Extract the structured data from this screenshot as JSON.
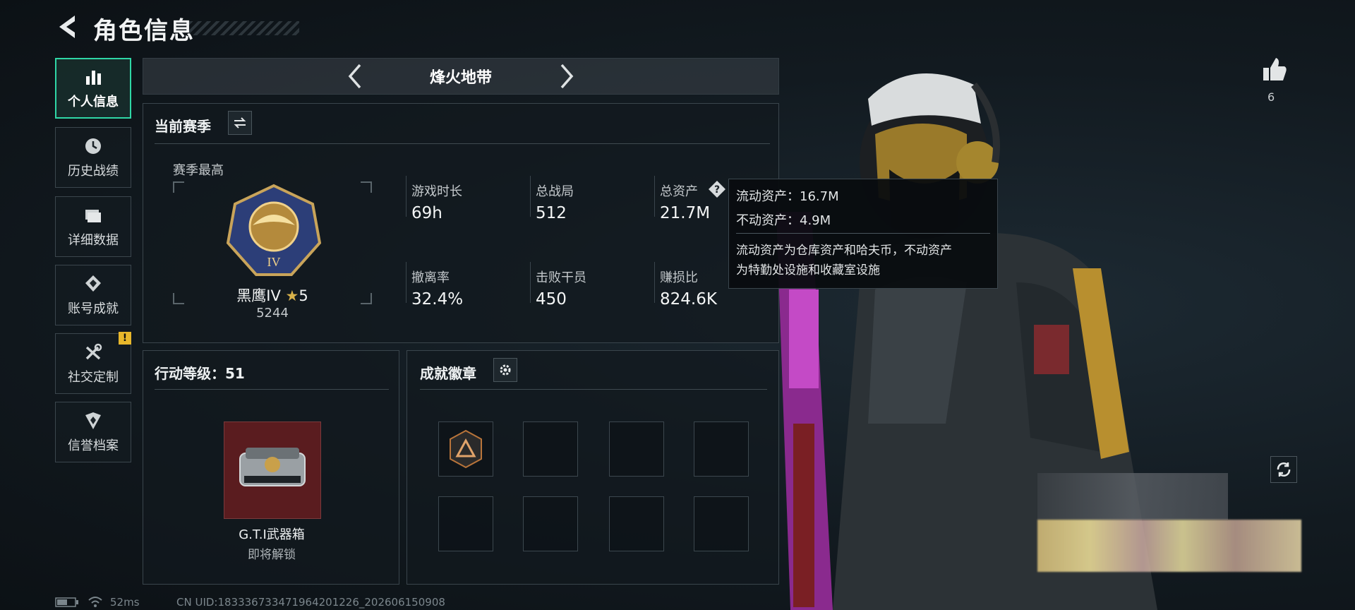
{
  "header": {
    "title": "角色信息"
  },
  "nav": [
    {
      "label": "个人信息",
      "icon": "bar-chart-icon",
      "active": true
    },
    {
      "label": "历史战绩",
      "icon": "clock-icon"
    },
    {
      "label": "详细数据",
      "icon": "folder-icon"
    },
    {
      "label": "账号成就",
      "icon": "achievement-icon"
    },
    {
      "label": "社交定制",
      "icon": "tools-icon",
      "alert": "!"
    },
    {
      "label": "信誉档案",
      "icon": "shield-icon"
    }
  ],
  "season_selector": {
    "name": "烽火地带"
  },
  "current_season": {
    "title": "当前赛季",
    "best_label": "赛季最高",
    "rank_name": "黑鹰IV",
    "rank_stars": "5",
    "rank_score": "5244",
    "stats": [
      {
        "label": "游戏时长",
        "value": "69h"
      },
      {
        "label": "总战局",
        "value": "512"
      },
      {
        "label": "总资产",
        "value": "21.7M"
      },
      {
        "label": "撤离率",
        "value": "32.4%"
      },
      {
        "label": "击败干员",
        "value": "450"
      },
      {
        "label": "赚损比",
        "value": "824.6K"
      }
    ]
  },
  "tooltip": {
    "line1": "流动资产：16.7M",
    "line2": "不动资产：4.9M",
    "desc1": "流动资产为仓库资产和哈夫币，不动资产",
    "desc2": "为特勤处设施和收藏室设施"
  },
  "action_level": {
    "title": "行动等级：51",
    "reward_name": "G.T.I武器箱",
    "reward_status": "即将解锁"
  },
  "achievements": {
    "title": "成就徽章"
  },
  "likes": {
    "count": "6"
  },
  "footer": {
    "ping": "52ms",
    "uid": "CN UID:18333673347196420122​6_202606150908"
  },
  "colors": {
    "accent": "#2fd7a6",
    "alert": "#e8b72b",
    "reward_bg": "#5a1c1f"
  }
}
